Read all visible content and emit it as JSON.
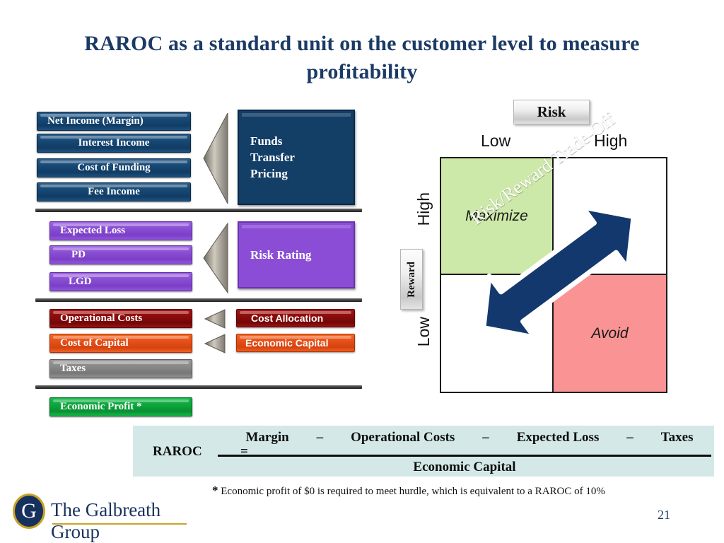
{
  "title": "RAROC as a standard unit on the customer level to measure profitability",
  "left_column": {
    "group_income": [
      {
        "label": "Net Income (Margin)"
      },
      {
        "label": "Interest Income"
      },
      {
        "label": "Cost of Funding"
      },
      {
        "label": "Fee Income"
      }
    ],
    "group_loss": [
      {
        "label": "Expected Loss"
      },
      {
        "label": "PD"
      },
      {
        "label": "LGD"
      }
    ],
    "group_costs": [
      {
        "label": "Operational Costs"
      },
      {
        "label": "Cost of Capital"
      },
      {
        "label": "Taxes"
      }
    ],
    "group_result": [
      {
        "label": "Economic Profit *"
      }
    ]
  },
  "middle_column": {
    "funds_transfer_pricing": "Funds Transfer Pricing",
    "risk_rating": "Risk Rating",
    "cost_allocation": "Cost Allocation",
    "economic_capital": "Economic Capital"
  },
  "matrix": {
    "top_pill": "Risk",
    "side_pill": "Reward",
    "x_axis": {
      "low": "Low",
      "high": "High"
    },
    "y_axis": {
      "high": "High",
      "low": "Low"
    },
    "quadrants": {
      "top_left": "Maximize",
      "top_right": "",
      "bottom_left": "",
      "bottom_right": "Avoid"
    },
    "arrow_label": "Risk/Reward Trade-Off"
  },
  "formula": {
    "lhs": "RAROC",
    "equals": "=",
    "numerator": [
      "Margin",
      "–",
      "Operational Costs",
      "–",
      "Expected Loss",
      "–",
      "Taxes"
    ],
    "denominator": "Economic Capital"
  },
  "footnote": {
    "star": "*",
    "text": "Economic profit of $0 is required to meet hurdle, which is equivalent to a RAROC of 10%"
  },
  "logo": {
    "monogram": "G",
    "name": "The Galbreath Group"
  },
  "page_number": "21",
  "colors": {
    "title_navy": "#1b3a66",
    "box_blue": "#174a77",
    "box_purple": "#8a4fd3",
    "box_darkred": "#8e0d0d",
    "box_orange": "#e8521a",
    "box_gray": "#8a8a8a",
    "box_green": "#0ea83e",
    "quadrant_green": "#cde9a9",
    "quadrant_pink": "#fa9393",
    "arrow_navy": "#13386d",
    "formula_bg": "#d4e9e7",
    "logo_gold": "#c9a227"
  }
}
